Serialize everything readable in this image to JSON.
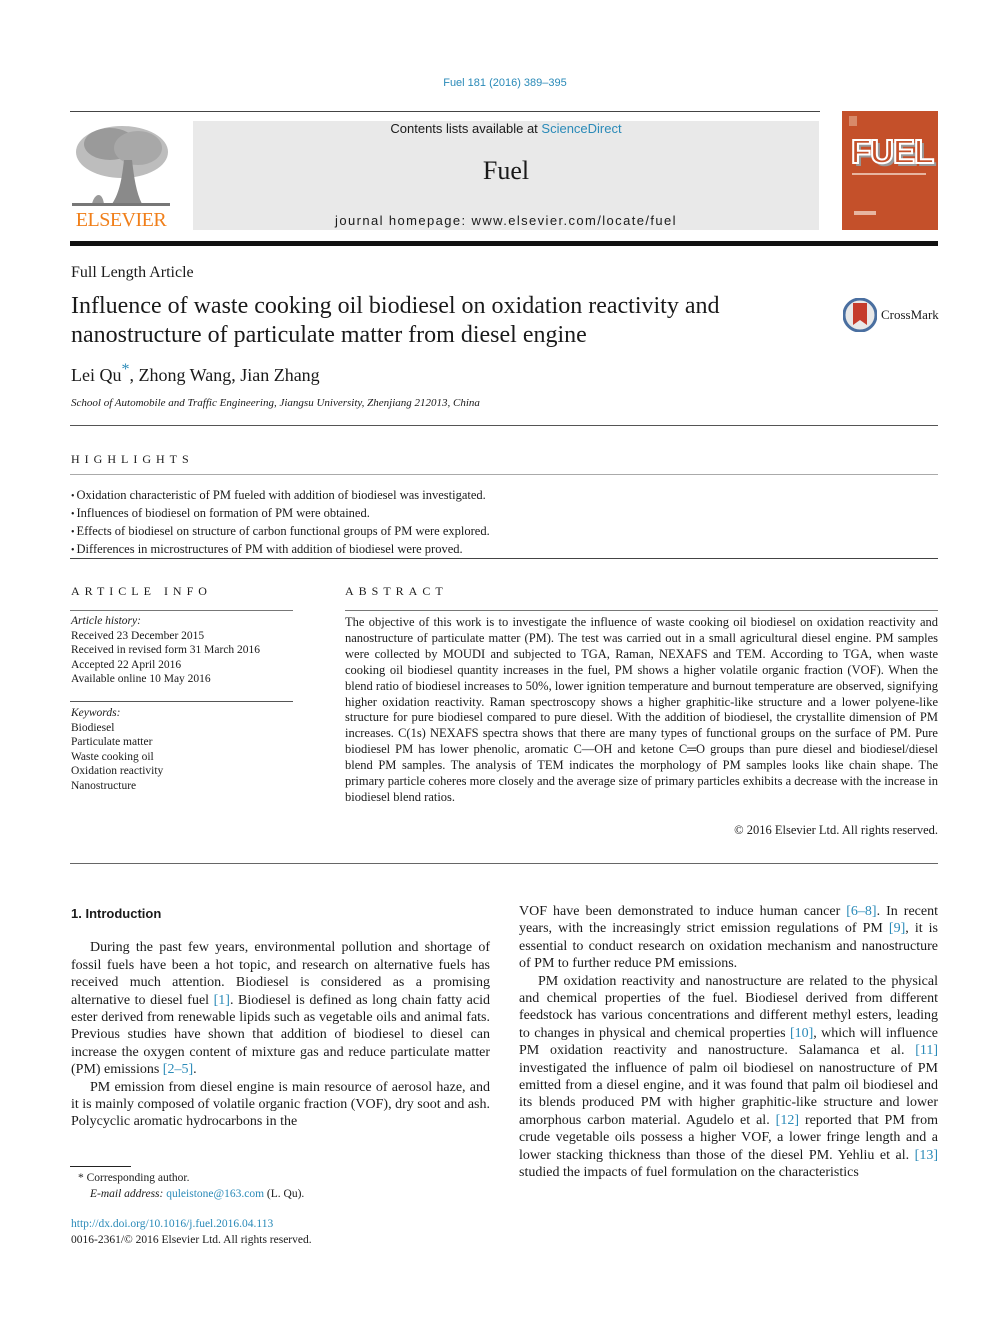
{
  "header": {
    "journal_ref": "Fuel 181 (2016) 389–395",
    "contents_prefix": "Contents lists available at ",
    "contents_link": "ScienceDirect",
    "journal_name": "Fuel",
    "homepage": "journal homepage: www.elsevier.com/locate/fuel",
    "publisher_logo": "ELSEVIER",
    "cover_title": "FUEL",
    "crossmark_label": "CrossMark",
    "colors": {
      "link": "#2a8ab8",
      "elsevier_orange": "#f07f1a",
      "cover": "#c4502a",
      "header_bg": "#e9e9e9"
    }
  },
  "article": {
    "type": "Full Length Article",
    "title": "Influence of waste cooking oil biodiesel on oxidation reactivity and nanostructure of particulate matter from diesel engine",
    "authors": [
      {
        "name": "Lei Qu",
        "corresponding": true,
        "sep": ", "
      },
      {
        "name": "Zhong Wang",
        "sep": ", "
      },
      {
        "name": "Jian Zhang",
        "sep": ""
      }
    ],
    "affiliation": "School of Automobile and Traffic Engineering, Jiangsu University, Zhenjiang 212013, China"
  },
  "highlights": {
    "heading": "HIGHLIGHTS",
    "items": [
      "Oxidation characteristic of PM fueled with addition of biodiesel was investigated.",
      "Influences of biodiesel on formation of PM were obtained.",
      "Effects of biodiesel on structure of carbon functional groups of PM were explored.",
      "Differences in microstructures of PM with addition of biodiesel were proved."
    ]
  },
  "article_info": {
    "heading": "ARTICLE INFO",
    "history_label": "Article history:",
    "history": [
      "Received 23 December 2015",
      "Received in revised form 31 March 2016",
      "Accepted 22 April 2016",
      "Available online 10 May 2016"
    ],
    "keywords_label": "Keywords:",
    "keywords": [
      "Biodiesel",
      "Particulate matter",
      "Waste cooking oil",
      "Oxidation reactivity",
      "Nanostructure"
    ]
  },
  "abstract": {
    "heading": "ABSTRACT",
    "text": "The objective of this work is to investigate the influence of waste cooking oil biodiesel on oxidation reactivity and nanostructure of particulate matter (PM). The test was carried out in a small agricultural diesel engine. PM samples were collected by MOUDI and subjected to TGA, Raman, NEXAFS and TEM. According to TGA, when waste cooking oil biodiesel quantity increases in the fuel, PM shows a higher volatile organic fraction (VOF). When the blend ratio of biodiesel increases to 50%, lower ignition temperature and burnout temperature are observed, signifying higher oxidation reactivity. Raman spectroscopy shows a higher graphitic-like structure and a lower polyene-like structure for pure biodiesel compared to pure diesel. With the addition of biodiesel, the crystallite dimension of PM increases. C(1s) NEXAFS spectra shows that there are many types of functional groups on the surface of PM. Pure biodiesel PM has lower phenolic, aromatic C—OH and ketone C═O groups than pure diesel and biodiesel/diesel blend PM samples. The analysis of TEM indicates the morphology of PM samples looks like chain shape. The primary particle coheres more closely and the average size of primary particles exhibits a decrease with the increase in biodiesel blend ratios.",
    "copyright": "© 2016 Elsevier Ltd. All rights reserved."
  },
  "body": {
    "intro_heading": "1. Introduction",
    "left_paragraphs": [
      [
        {
          "t": "During the past few years, environmental pollution and shortage of fossil fuels have been a hot topic, and research on alternative fuels has received much attention. Biodiesel is considered as a promising alternative to diesel fuel "
        },
        {
          "ref": "[1]"
        },
        {
          "t": ". Biodiesel is defined as long chain fatty acid ester derived from renewable lipids such as vegetable oils and animal fats. Previous studies have shown that addition of biodiesel to diesel can increase the oxygen content of mixture gas and reduce particulate matter (PM) emissions "
        },
        {
          "ref": "[2–5]"
        },
        {
          "t": "."
        }
      ],
      [
        {
          "t": "PM emission from diesel engine is main resource of aerosol haze, and it is mainly composed of volatile organic fraction (VOF), dry soot and ash. Polycyclic aromatic hydrocarbons in the"
        }
      ]
    ],
    "right_paragraphs": [
      [
        {
          "t": "VOF have been demonstrated to induce human cancer "
        },
        {
          "ref": "[6–8]"
        },
        {
          "t": ". In recent years, with the increasingly strict emission regulations of PM "
        },
        {
          "ref": "[9]"
        },
        {
          "t": ", it is essential to conduct research on oxidation mechanism and nanostructure of PM to further reduce PM emissions."
        }
      ],
      [
        {
          "t": "PM oxidation reactivity and nanostructure are related to the physical and chemical properties of the fuel. Biodiesel derived from different feedstock has various concentrations and different methyl esters, leading to changes in physical and chemical properties "
        },
        {
          "ref": "[10]"
        },
        {
          "t": ", which will influence PM oxidation reactivity and nanostructure. Salamanca et al. "
        },
        {
          "ref": "[11]"
        },
        {
          "t": " investigated the influence of palm oil biodiesel on nanostructure of PM emitted from a diesel engine, and it was found that palm oil biodiesel and its blends produced PM with higher graphitic-like structure and lower amorphous carbon material. Agudelo et al. "
        },
        {
          "ref": "[12]"
        },
        {
          "t": " reported that PM from crude vegetable oils possess a higher VOF, a lower fringe length and a lower stacking thickness than those of the diesel PM. Yehliu et al. "
        },
        {
          "ref": "[13]"
        },
        {
          "t": " studied the impacts of fuel formulation on the characteristics"
        }
      ]
    ]
  },
  "footnote": {
    "marker": "*",
    "corresponding": "Corresponding author.",
    "email_label": "E-mail address: ",
    "email": "quleistone@163.com",
    "email_suffix": " (L. Qu).",
    "doi": "http://dx.doi.org/10.1016/j.fuel.2016.04.113",
    "issn_line": "0016-2361/© 2016 Elsevier Ltd. All rights reserved."
  }
}
